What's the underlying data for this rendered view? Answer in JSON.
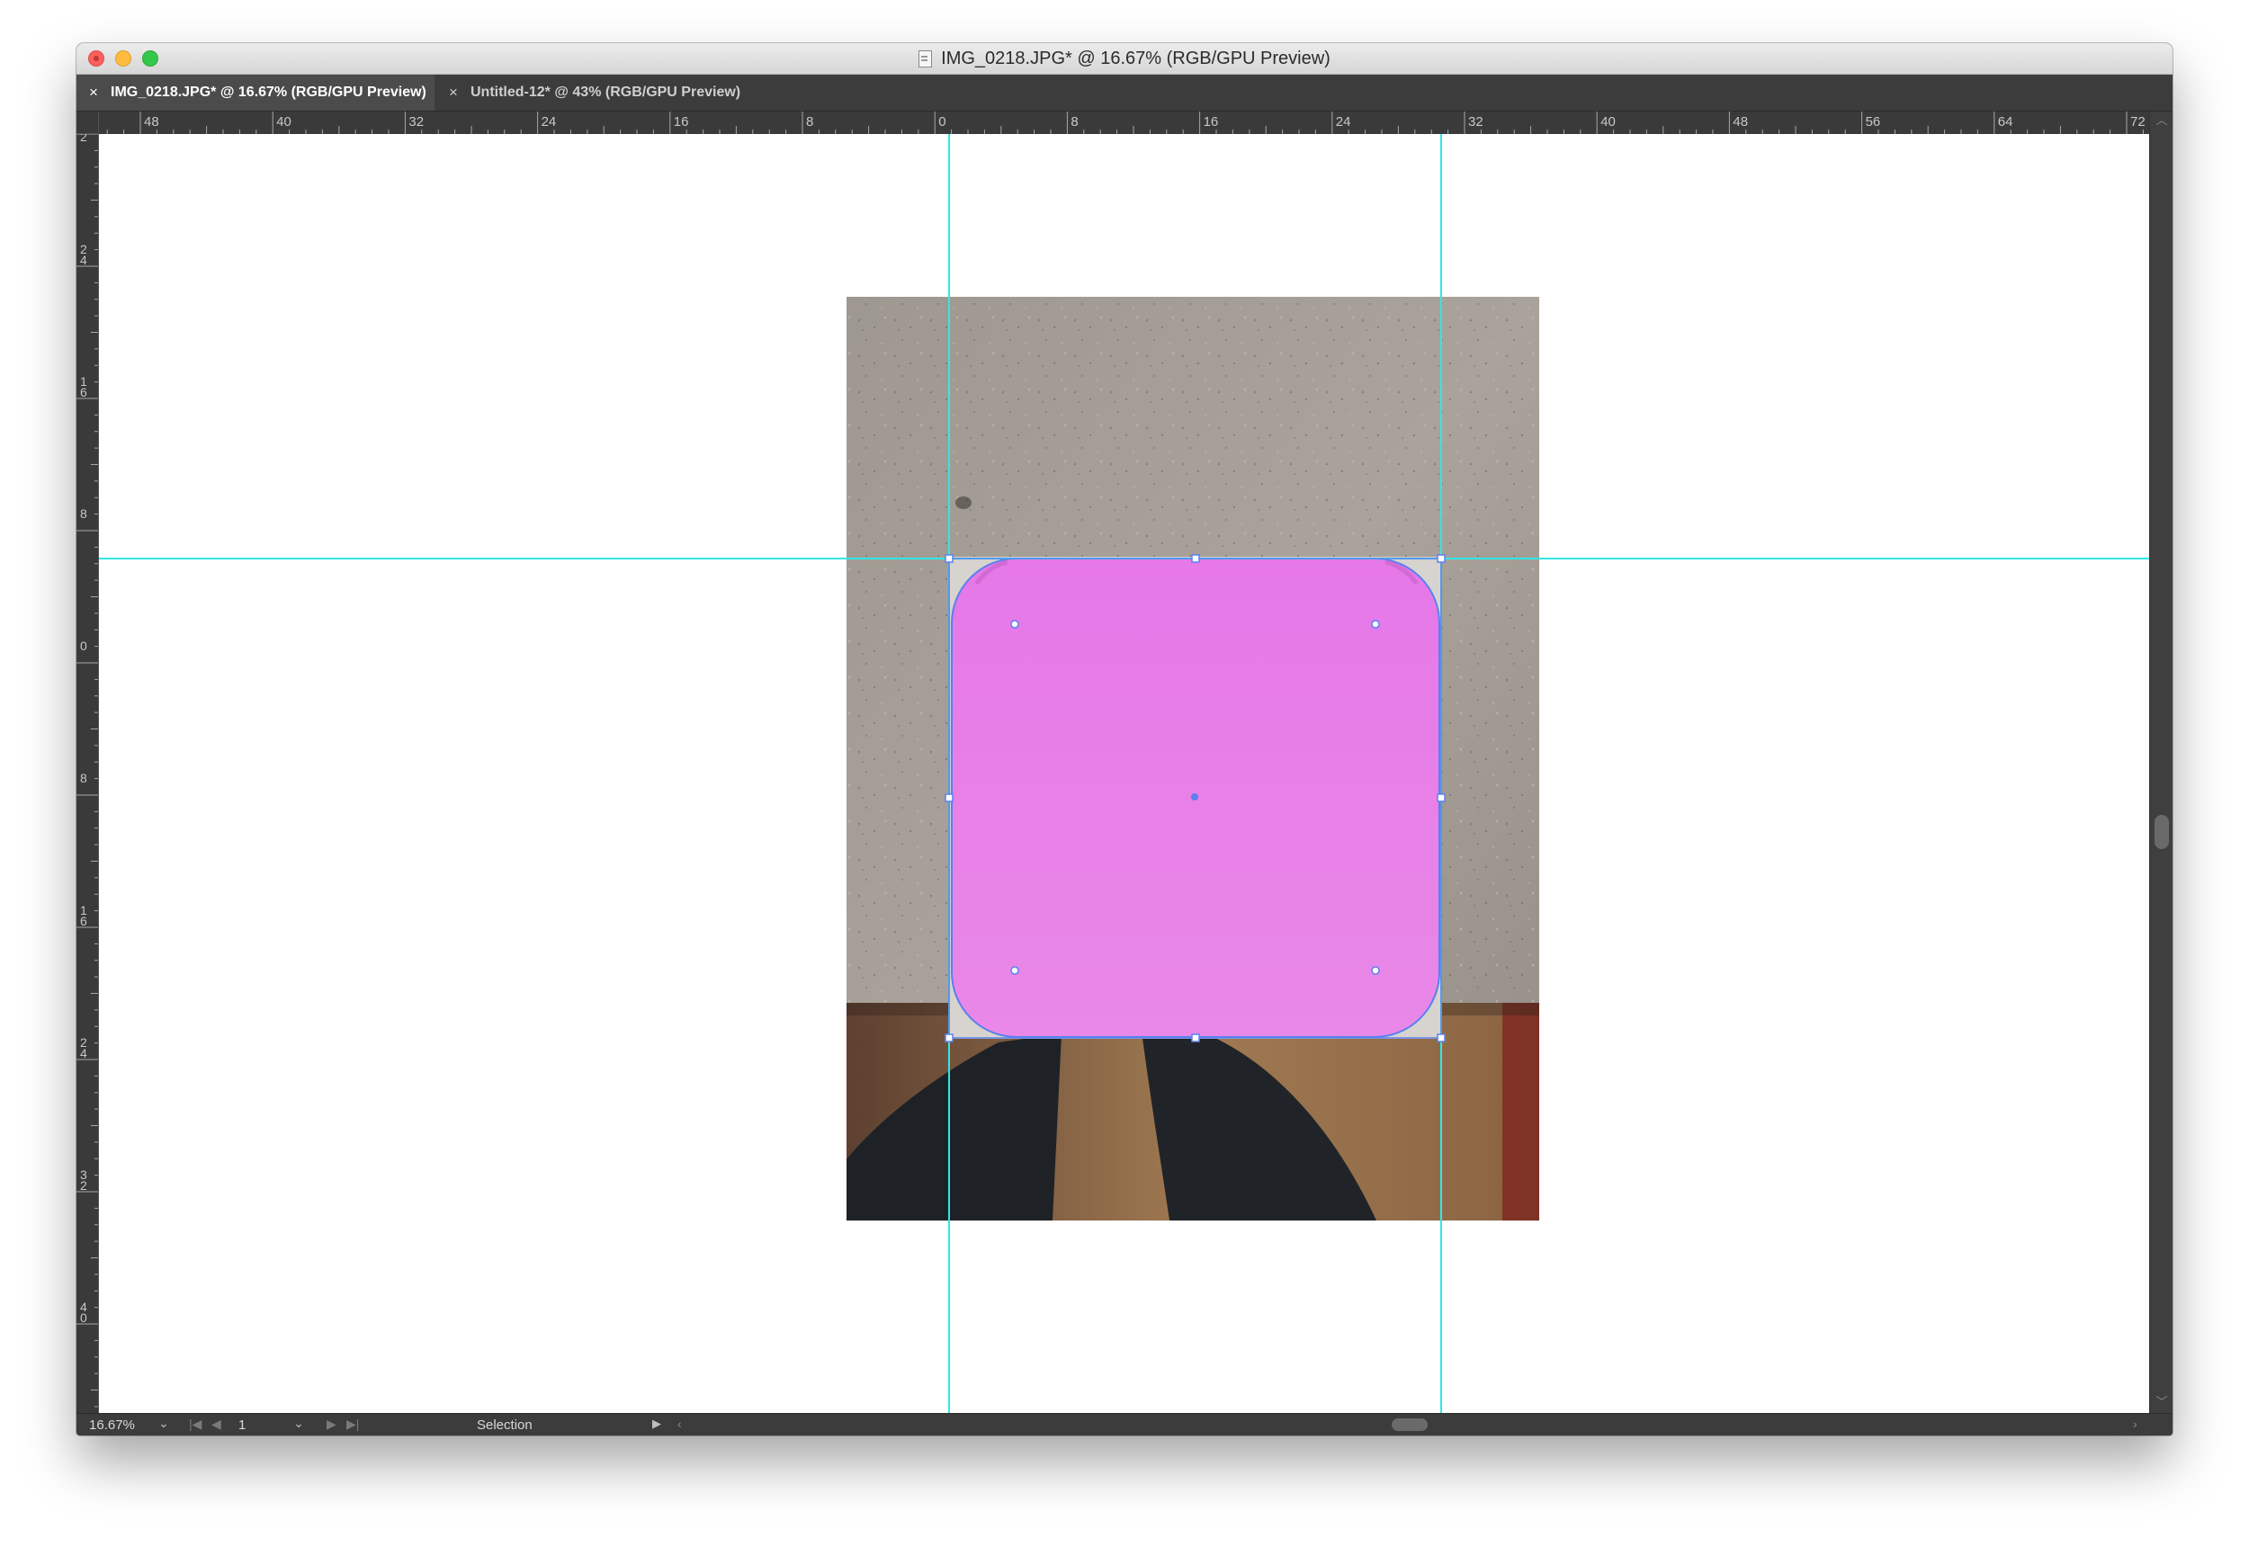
{
  "window": {
    "title": "IMG_0218.JPG* @ 16.67% (RGB/GPU Preview)"
  },
  "tabs": [
    {
      "label": "IMG_0218.JPG* @ 16.67% (RGB/GPU Preview)",
      "active": true
    },
    {
      "label": "Untitled-12* @ 43% (RGB/GPU Preview)",
      "active": false
    }
  ],
  "rulers": {
    "horizontal_labels": [
      "48",
      "40",
      "32",
      "24",
      "16",
      "8",
      "0",
      "8",
      "16",
      "24",
      "32",
      "40",
      "48",
      "56",
      "64",
      "72"
    ],
    "vertical_labels": [
      "2",
      "24",
      "16",
      "8",
      "0",
      "8",
      "16",
      "24",
      "32",
      "40"
    ]
  },
  "status": {
    "zoom": "16.67%",
    "page": "1",
    "tool": "Selection"
  },
  "colors": {
    "shape_fill": "#e880e8",
    "guide": "#32e6e6",
    "selection": "#5a80f0"
  },
  "icons": {
    "close": "close-icon",
    "document": "document-icon",
    "chevron": "chevron-down-icon"
  }
}
